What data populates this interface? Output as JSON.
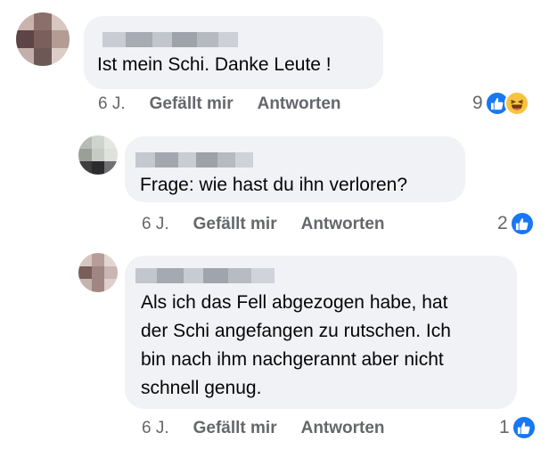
{
  "colors": {
    "bubble": "#f0f2f5",
    "text": "#050505",
    "meta": "#65676b",
    "like": "#1877f2",
    "haha": "#f7c33f"
  },
  "comments": [
    {
      "text": "Ist mein Schi. Danke Leute !",
      "time": "6 J.",
      "like_label": "Gefällt mir",
      "reply_label": "Antworten",
      "reaction_count": "9",
      "reactions": [
        "like-icon",
        "haha-icon"
      ]
    },
    {
      "text": "Frage: wie hast du ihn verloren?",
      "time": "6 J.",
      "like_label": "Gefällt mir",
      "reply_label": "Antworten",
      "reaction_count": "2",
      "reactions": [
        "like-icon"
      ]
    },
    {
      "text_lines": [
        "Als ich das Fell abgezogen habe, hat",
        "der Schi angefangen zu rutschen. Ich",
        "bin nach ihm nachgerannt aber nicht",
        "schnell genug."
      ],
      "time": "6 J.",
      "like_label": "Gefällt mir",
      "reply_label": "Antworten",
      "reaction_count": "1",
      "reactions": [
        "like-icon"
      ]
    }
  ]
}
